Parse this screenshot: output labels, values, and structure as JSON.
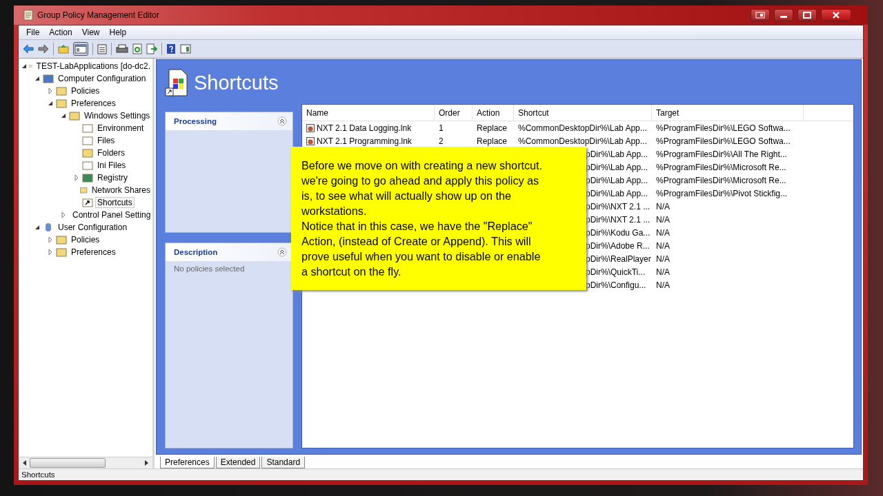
{
  "window": {
    "title": "Group Policy Management Editor"
  },
  "menu": [
    "File",
    "Action",
    "View",
    "Help"
  ],
  "tree": [
    {
      "label": "TEST-LabApplications [do-dc2.",
      "kind": "policy",
      "expanded": true,
      "selected": false,
      "children": [
        {
          "label": "Computer Configuration",
          "kind": "computer",
          "expanded": true,
          "selected": false,
          "children": [
            {
              "label": "Policies",
              "kind": "folder",
              "expanded": false,
              "selected": false
            },
            {
              "label": "Preferences",
              "kind": "folder",
              "expanded": true,
              "selected": false,
              "children": [
                {
                  "label": "Windows Settings",
                  "kind": "folder",
                  "expanded": true,
                  "selected": false,
                  "children": [
                    {
                      "label": "Environment",
                      "kind": "document",
                      "selected": false
                    },
                    {
                      "label": "Files",
                      "kind": "document",
                      "selected": false
                    },
                    {
                      "label": "Folders",
                      "kind": "folder",
                      "selected": false
                    },
                    {
                      "label": "Ini Files",
                      "kind": "document",
                      "selected": false
                    },
                    {
                      "label": "Registry",
                      "kind": "registry",
                      "expanded": false,
                      "selected": false
                    },
                    {
                      "label": "Network Shares",
                      "kind": "folder",
                      "selected": false
                    },
                    {
                      "label": "Shortcuts",
                      "kind": "shortcut",
                      "selected": true
                    }
                  ]
                },
                {
                  "label": "Control Panel Setting",
                  "kind": "folder",
                  "expanded": false,
                  "selected": false
                }
              ]
            }
          ]
        },
        {
          "label": "User Configuration",
          "kind": "user",
          "expanded": true,
          "selected": false,
          "children": [
            {
              "label": "Policies",
              "kind": "folder",
              "expanded": false,
              "selected": false
            },
            {
              "label": "Preferences",
              "kind": "folder",
              "expanded": false,
              "selected": false
            }
          ]
        }
      ]
    }
  ],
  "content": {
    "title": "Shortcuts",
    "panels": [
      {
        "title": "Processing",
        "expanded": true
      },
      {
        "title": "Description",
        "expanded": true,
        "text": "No policies selected"
      }
    ],
    "table": {
      "columns": [
        "Name",
        "Order",
        "Action",
        "Shortcut",
        "Target"
      ],
      "rows": [
        {
          "kind": "full",
          "name": "NXT 2.1 Data Logging.lnk",
          "order": "1",
          "action": "Replace",
          "shortcut": "%CommonDesktopDir%\\Lab App...",
          "target": "%ProgramFilesDir%\\LEGO Softwa..."
        },
        {
          "kind": "full",
          "name": "NXT 2.1 Programming.lnk",
          "order": "2",
          "action": "Replace",
          "shortcut": "%CommonDesktopDir%\\Lab App...",
          "target": "%ProgramFilesDir%\\LEGO Softwa..."
        },
        {
          "kind": "covered",
          "shortcut": "pDir%\\Lab App...",
          "target": "%ProgramFilesDir%\\All The Right..."
        },
        {
          "kind": "covered",
          "shortcut": "pDir%\\Lab App...",
          "target": "%ProgramFilesDir%\\Microsoft Re..."
        },
        {
          "kind": "covered",
          "shortcut": "pDir%\\Lab App...",
          "target": "%ProgramFilesDir%\\Microsoft Re..."
        },
        {
          "kind": "covered",
          "shortcut": "pDir%\\Lab App...",
          "target": "%ProgramFilesDir%\\Pivot Stickfig..."
        },
        {
          "kind": "covered",
          "shortcut": "pDir%\\NXT 2.1 ...",
          "target": "N/A"
        },
        {
          "kind": "covered",
          "shortcut": "pDir%\\NXT 2.1 ...",
          "target": "N/A"
        },
        {
          "kind": "covered",
          "shortcut": "pDir%\\Kodu Ga...",
          "target": "N/A"
        },
        {
          "kind": "covered",
          "shortcut": "pDir%\\Adobe R...",
          "target": "N/A"
        },
        {
          "kind": "covered",
          "shortcut": "pDir%\\RealPlayer",
          "target": "N/A"
        },
        {
          "kind": "covered",
          "shortcut": "pDir%\\QuickTi...",
          "target": "N/A"
        },
        {
          "kind": "covered",
          "shortcut": "pDir%\\Configu...",
          "target": "N/A"
        }
      ]
    },
    "callout": [
      "Before we move on with creating a new shortcut.",
      "we're going to go ahead and apply this policy as",
      "is, to see what will actually show up on the",
      "workstations.",
      "Notice that in this case, we have the \"Replace\"",
      "Action, (instead of Create or Append). This will",
      "prove useful when you want to disable or enable",
      "a shortcut on the fly."
    ],
    "tabs": [
      {
        "label": "Preferences",
        "selected": true
      },
      {
        "label": "Extended",
        "selected": false
      },
      {
        "label": "Standard",
        "selected": false
      }
    ]
  },
  "status_bar": "Shortcuts"
}
